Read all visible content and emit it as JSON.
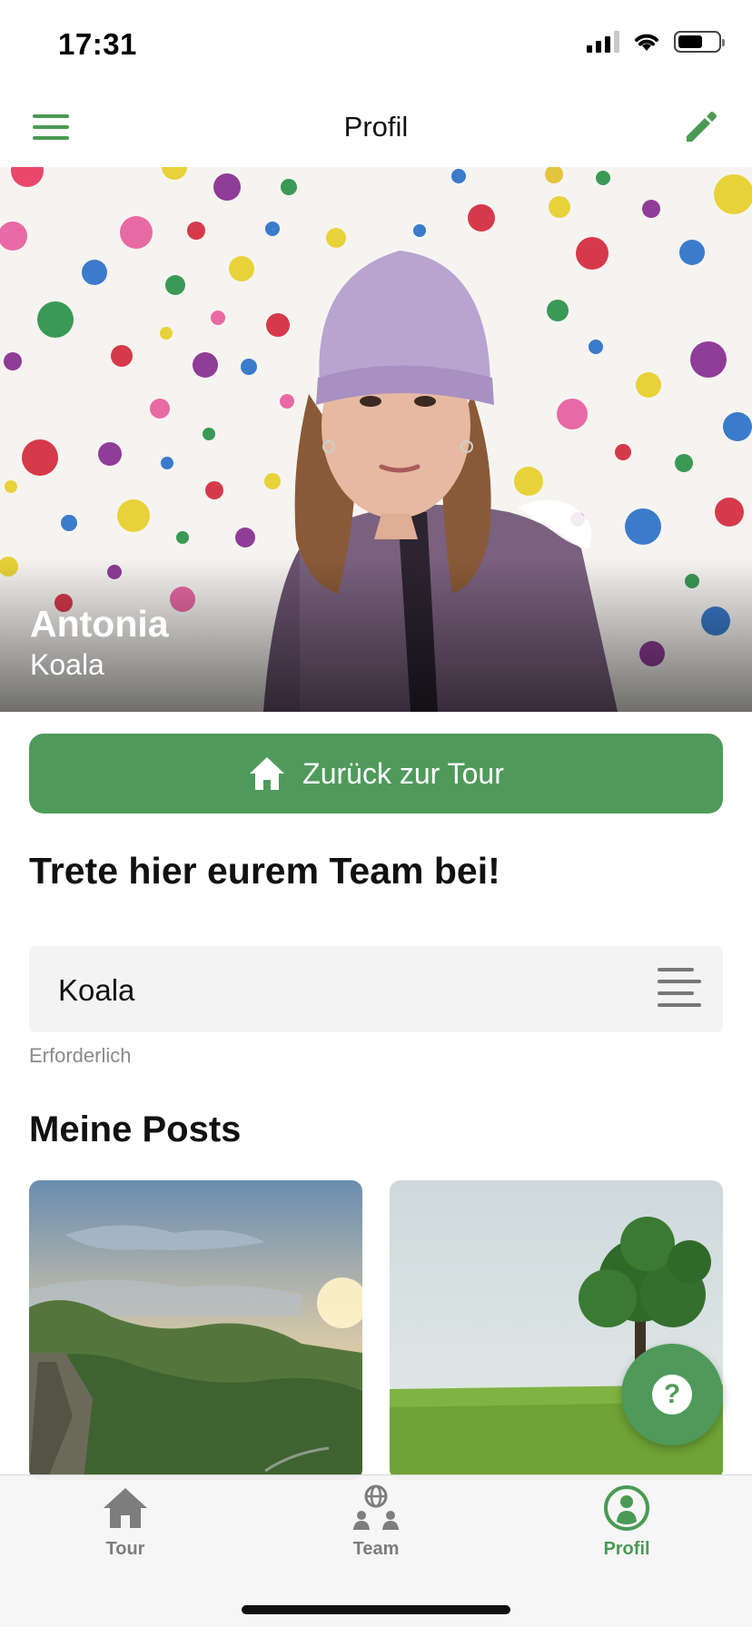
{
  "status_bar": {
    "time": "17:31",
    "icons": [
      "cellular-signal-icon",
      "wifi-icon",
      "battery-icon"
    ]
  },
  "nav": {
    "title": "Profil",
    "left_icon": "hamburger-menu-icon",
    "right_icon": "edit-pencil-icon"
  },
  "profile": {
    "name": "Antonia",
    "team": "Koala"
  },
  "back_button": {
    "label": "Zurück zur Tour",
    "icon": "home-icon"
  },
  "join": {
    "heading": "Trete hier eurem Team bei!",
    "selected_team": "Koala",
    "helper": "Erforderlich"
  },
  "posts": {
    "heading": "Meine Posts"
  },
  "help": {
    "label": "?"
  },
  "tabs": [
    {
      "label": "Tour",
      "icon": "home-icon",
      "active": false
    },
    {
      "label": "Team",
      "icon": "team-globe-icon",
      "active": false
    },
    {
      "label": "Profil",
      "icon": "profile-icon",
      "active": true
    }
  ],
  "colors": {
    "accent": "#4f9a5a",
    "tab_inactive": "#7d7d7d",
    "input_bg": "#f3f3f3",
    "helper_text": "#8a8a8a"
  }
}
